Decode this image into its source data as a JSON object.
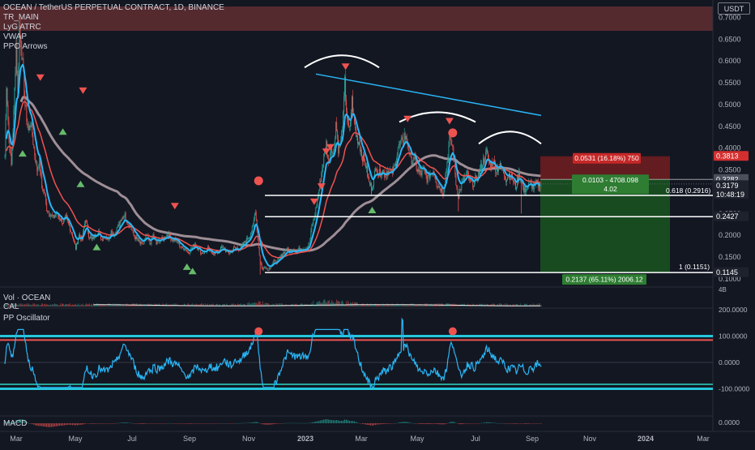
{
  "header": {
    "title": "OCEAN / TetherUS PERPETUAL CONTRACT, 1D, BINANCE",
    "currency_button": "USDT",
    "indicators": [
      "TR_MAIN",
      "LyG ATRC",
      "VWAP",
      "PPO Arrows"
    ]
  },
  "colors": {
    "background": "#131722",
    "candle_up": "#26a69a",
    "candle_down": "#ef5350",
    "fast_ma": "#29b6f6",
    "slow_ma": "#ef5350",
    "long_ma": "#9e8e96",
    "trendline": "#29b6f6",
    "arc": "#ffffff",
    "level_line": "#ffffff",
    "risk_zone": "#7f1f1f",
    "reward_zone": "#1b5e20",
    "oscillator": "#29b6f6",
    "osc_upper_band": "#26c6da",
    "osc_red_band": "#ef5350",
    "osc_green_band": "#26a69a",
    "top_red_zone": "#8b3a3a"
  },
  "price_axis": {
    "ticks": [
      "0.7000",
      "0.6500",
      "0.6000",
      "0.5500",
      "0.5000",
      "0.4500",
      "0.4000",
      "0.3500",
      "0.3000",
      "0.2500",
      "0.2000",
      "0.1500",
      "0.1000"
    ],
    "labels": [
      {
        "text": "0.3813",
        "kind": "red"
      },
      {
        "text": "0.3282",
        "kind": "gray"
      },
      {
        "text": "0.3179",
        "kind": "dark"
      },
      {
        "text": "10:48:19",
        "kind": "dark"
      },
      {
        "text": "0.2427",
        "kind": "dark"
      },
      {
        "text": "0.1145",
        "kind": "dark"
      }
    ]
  },
  "annotations": {
    "fib_618": "0.618 (0.2916)",
    "fib_1": "1 (0.1151)",
    "risk_label": "0.0531 (16.18%) 750",
    "position_label_line1": "0.0103 - 4708.098",
    "position_label_line2": "4.02",
    "reward_label": "0.2137 (65.11%) 2006.12"
  },
  "volume_pane": {
    "title": "Vol · OCEAN",
    "subtitle": "CAL",
    "tick": "4B"
  },
  "oscillator_pane": {
    "title": "PP Oscillator",
    "ticks": [
      "200.0000",
      "100.0000",
      "0.0000",
      "-100.0000"
    ]
  },
  "macd_pane": {
    "title": "MACD",
    "tick": "0.0000"
  },
  "time_axis": [
    "Mar",
    "May",
    "Jul",
    "Sep",
    "Nov",
    "2023",
    "Mar",
    "May",
    "Jul",
    "Sep",
    "Nov",
    "2024",
    "Mar"
  ],
  "chart_data": {
    "type": "candlestick",
    "title": "OCEAN / TetherUS PERPETUAL CONTRACT, 1D, BINANCE",
    "ylim": [
      0.085,
      0.725
    ],
    "y_ticks": [
      0.1,
      0.15,
      0.2,
      0.25,
      0.3,
      0.35,
      0.4,
      0.45,
      0.5,
      0.55,
      0.6,
      0.65,
      0.7
    ],
    "x_ticks": [
      "Mar",
      "May",
      "Jul",
      "Sep",
      "Nov",
      "2023",
      "Mar",
      "May",
      "Jul",
      "Sep",
      "Nov",
      "2024",
      "Mar"
    ],
    "price_path": [
      [
        0,
        0.38
      ],
      [
        2,
        0.55
      ],
      [
        5,
        0.42
      ],
      [
        8,
        0.36
      ],
      [
        11,
        0.48
      ],
      [
        14,
        0.64
      ],
      [
        16,
        0.52
      ],
      [
        18,
        0.68
      ],
      [
        21,
        0.62
      ],
      [
        25,
        0.5
      ],
      [
        29,
        0.44
      ],
      [
        32,
        0.46
      ],
      [
        36,
        0.4
      ],
      [
        40,
        0.35
      ],
      [
        43,
        0.37
      ],
      [
        46,
        0.31
      ],
      [
        49,
        0.3
      ],
      [
        52,
        0.26
      ],
      [
        56,
        0.25
      ],
      [
        60,
        0.24
      ],
      [
        64,
        0.25
      ],
      [
        68,
        0.24
      ],
      [
        72,
        0.23
      ],
      [
        76,
        0.24
      ],
      [
        80,
        0.22
      ],
      [
        84,
        0.2
      ],
      [
        88,
        0.17
      ],
      [
        92,
        0.2
      ],
      [
        96,
        0.19
      ],
      [
        100,
        0.24
      ],
      [
        104,
        0.2
      ],
      [
        108,
        0.19
      ],
      [
        112,
        0.2
      ],
      [
        116,
        0.21
      ],
      [
        120,
        0.19
      ],
      [
        124,
        0.2
      ],
      [
        128,
        0.19
      ],
      [
        132,
        0.21
      ],
      [
        136,
        0.2
      ],
      [
        140,
        0.22
      ],
      [
        144,
        0.23
      ],
      [
        148,
        0.25
      ],
      [
        152,
        0.23
      ],
      [
        156,
        0.22
      ],
      [
        160,
        0.2
      ],
      [
        164,
        0.19
      ],
      [
        168,
        0.18
      ],
      [
        172,
        0.18
      ],
      [
        176,
        0.2
      ],
      [
        180,
        0.18
      ],
      [
        184,
        0.2
      ],
      [
        188,
        0.18
      ],
      [
        192,
        0.19
      ],
      [
        196,
        0.19
      ],
      [
        200,
        0.2
      ],
      [
        204,
        0.2
      ],
      [
        208,
        0.19
      ],
      [
        212,
        0.19
      ],
      [
        216,
        0.18
      ],
      [
        220,
        0.17
      ],
      [
        224,
        0.17
      ],
      [
        228,
        0.16
      ],
      [
        232,
        0.17
      ],
      [
        236,
        0.18
      ],
      [
        240,
        0.17
      ],
      [
        244,
        0.16
      ],
      [
        248,
        0.16
      ],
      [
        252,
        0.17
      ],
      [
        256,
        0.16
      ],
      [
        260,
        0.16
      ],
      [
        264,
        0.16
      ],
      [
        268,
        0.17
      ],
      [
        272,
        0.17
      ],
      [
        276,
        0.16
      ],
      [
        280,
        0.16
      ],
      [
        284,
        0.17
      ],
      [
        288,
        0.17
      ],
      [
        292,
        0.17
      ],
      [
        296,
        0.18
      ],
      [
        300,
        0.19
      ],
      [
        304,
        0.2
      ],
      [
        308,
        0.22
      ],
      [
        311,
        0.26
      ],
      [
        314,
        0.19
      ],
      [
        317,
        0.14
      ],
      [
        320,
        0.12
      ],
      [
        323,
        0.13
      ],
      [
        326,
        0.12
      ],
      [
        330,
        0.13
      ],
      [
        334,
        0.14
      ],
      [
        338,
        0.14
      ],
      [
        342,
        0.15
      ],
      [
        346,
        0.16
      ],
      [
        350,
        0.17
      ],
      [
        354,
        0.16
      ],
      [
        358,
        0.17
      ],
      [
        362,
        0.16
      ],
      [
        366,
        0.17
      ],
      [
        370,
        0.17
      ],
      [
        374,
        0.17
      ],
      [
        378,
        0.18
      ],
      [
        381,
        0.22
      ],
      [
        384,
        0.24
      ],
      [
        388,
        0.28
      ],
      [
        392,
        0.33
      ],
      [
        396,
        0.38
      ],
      [
        399,
        0.41
      ],
      [
        402,
        0.36
      ],
      [
        405,
        0.41
      ],
      [
        408,
        0.38
      ],
      [
        411,
        0.46
      ],
      [
        414,
        0.4
      ],
      [
        417,
        0.41
      ],
      [
        420,
        0.47
      ],
      [
        422,
        0.55
      ],
      [
        424,
        0.49
      ],
      [
        426,
        0.45
      ],
      [
        428,
        0.44
      ],
      [
        431,
        0.51
      ],
      [
        433,
        0.47
      ],
      [
        436,
        0.43
      ],
      [
        440,
        0.41
      ],
      [
        444,
        0.38
      ],
      [
        448,
        0.36
      ],
      [
        452,
        0.32
      ],
      [
        455,
        0.31
      ],
      [
        458,
        0.33
      ],
      [
        461,
        0.36
      ],
      [
        464,
        0.34
      ],
      [
        468,
        0.35
      ],
      [
        472,
        0.34
      ],
      [
        476,
        0.35
      ],
      [
        480,
        0.34
      ],
      [
        484,
        0.36
      ],
      [
        488,
        0.4
      ],
      [
        492,
        0.41
      ],
      [
        496,
        0.43
      ],
      [
        500,
        0.41
      ],
      [
        504,
        0.37
      ],
      [
        508,
        0.38
      ],
      [
        512,
        0.35
      ],
      [
        516,
        0.34
      ],
      [
        520,
        0.35
      ],
      [
        524,
        0.33
      ],
      [
        528,
        0.34
      ],
      [
        532,
        0.35
      ],
      [
        536,
        0.32
      ],
      [
        540,
        0.31
      ],
      [
        544,
        0.3
      ],
      [
        548,
        0.35
      ],
      [
        552,
        0.42
      ],
      [
        556,
        0.4
      ],
      [
        560,
        0.32
      ],
      [
        563,
        0.29
      ],
      [
        566,
        0.31
      ],
      [
        570,
        0.33
      ],
      [
        574,
        0.34
      ],
      [
        578,
        0.32
      ],
      [
        582,
        0.32
      ],
      [
        586,
        0.33
      ],
      [
        590,
        0.35
      ],
      [
        594,
        0.37
      ],
      [
        598,
        0.39
      ],
      [
        602,
        0.36
      ],
      [
        606,
        0.37
      ],
      [
        610,
        0.35
      ],
      [
        614,
        0.36
      ],
      [
        618,
        0.35
      ],
      [
        622,
        0.33
      ],
      [
        626,
        0.34
      ],
      [
        630,
        0.33
      ],
      [
        634,
        0.31
      ],
      [
        638,
        0.34
      ],
      [
        641,
        0.33
      ],
      [
        644,
        0.3
      ],
      [
        648,
        0.31
      ],
      [
        652,
        0.32
      ],
      [
        656,
        0.31
      ],
      [
        660,
        0.32
      ],
      [
        664,
        0.31
      ],
      [
        666,
        0.3179
      ]
    ],
    "lows": [
      [
        641,
        0.25
      ],
      [
        563,
        0.255
      ],
      [
        455,
        0.29
      ],
      [
        317,
        0.11
      ]
    ],
    "series": [
      {
        "name": "TR_MAIN",
        "type": "line"
      },
      {
        "name": "LyG ATRC",
        "type": "line"
      },
      {
        "name": "VWAP",
        "type": "line"
      }
    ],
    "horizontal_levels": [
      0.2916,
      0.2427,
      0.1145,
      0.1151
    ],
    "trade_box": {
      "entry": 0.3282,
      "stop": 0.3813,
      "target": 0.1145
    },
    "grid": false,
    "legend": "top-left"
  }
}
